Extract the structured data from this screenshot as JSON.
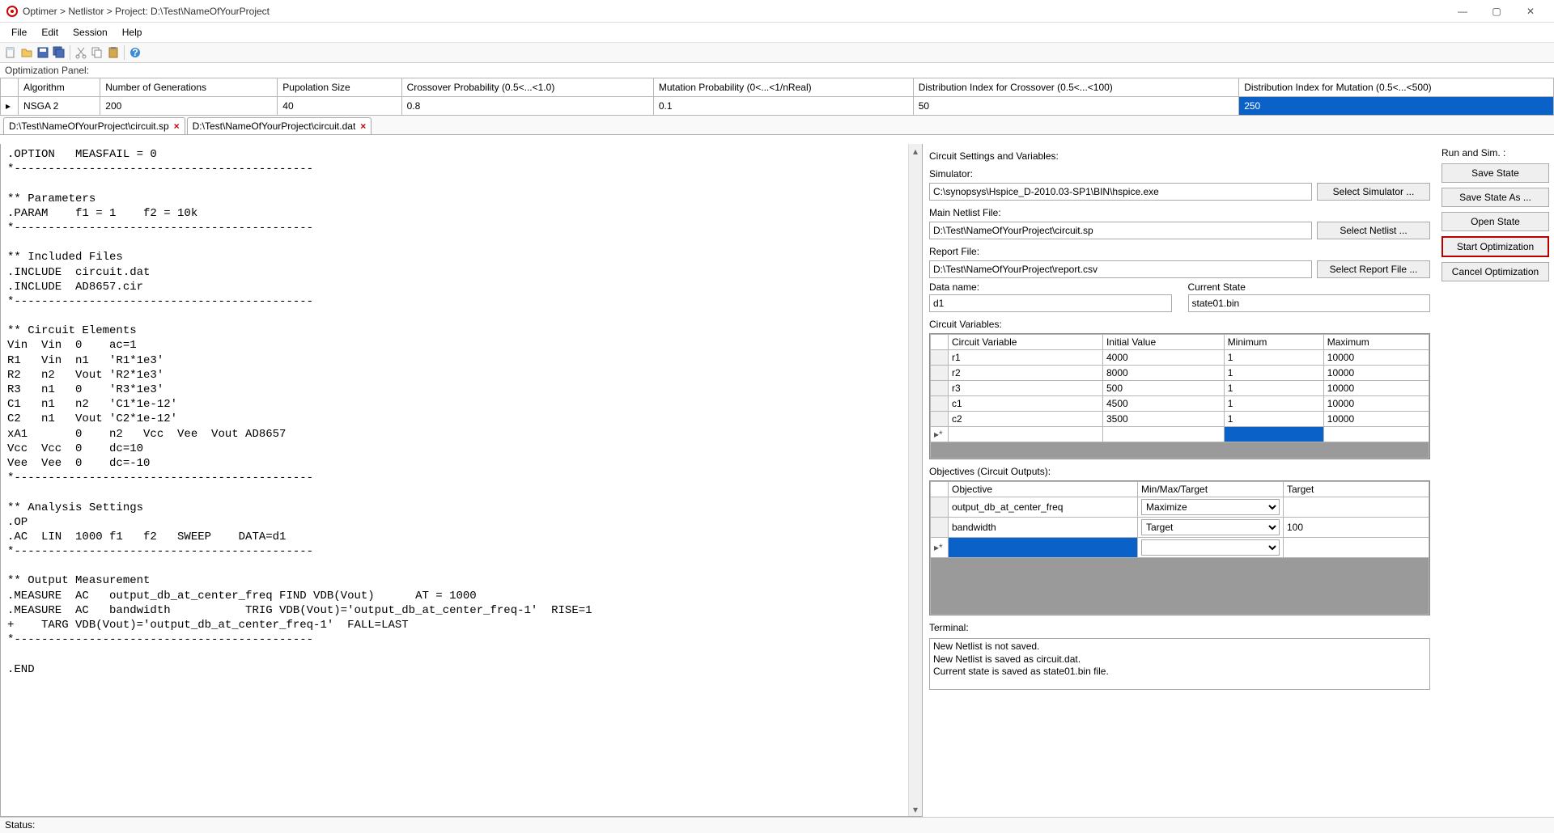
{
  "title": "Optimer > Netlistor > Project: D:\\Test\\NameOfYourProject",
  "menu": {
    "file": "File",
    "edit": "Edit",
    "session": "Session",
    "help": "Help"
  },
  "panel_label": "Optimization Panel:",
  "opt_headers": {
    "algorithm": "Algorithm",
    "generations": "Number of Generations",
    "popsize": "Pupolation Size",
    "crossover": "Crossover Probability (0.5<...<1.0)",
    "mutation": "Mutation Probability (0<...<1/nReal)",
    "dist_cross": "Distribution Index for Crossover (0.5<...<100)",
    "dist_mut": "Distribution Index for Mutation (0.5<...<500)"
  },
  "opt_row": {
    "algorithm": "NSGA 2",
    "generations": "200",
    "popsize": "40",
    "crossover": "0.8",
    "mutation": "0.1",
    "dist_cross": "50",
    "dist_mut": "250"
  },
  "tabs": {
    "t1": "D:\\Test\\NameOfYourProject\\circuit.sp",
    "t2": "D:\\Test\\NameOfYourProject\\circuit.dat"
  },
  "editor_text": ".OPTION   MEASFAIL = 0\n*--------------------------------------------\n\n** Parameters\n.PARAM    f1 = 1    f2 = 10k\n*--------------------------------------------\n\n** Included Files\n.INCLUDE  circuit.dat\n.INCLUDE  AD8657.cir\n*--------------------------------------------\n\n** Circuit Elements\nVin  Vin  0    ac=1\nR1   Vin  n1   'R1*1e3'\nR2   n2   Vout 'R2*1e3'\nR3   n1   0    'R3*1e3'\nC1   n1   n2   'C1*1e-12'\nC2   n1   Vout 'C2*1e-12'\nxA1       0    n2   Vcc  Vee  Vout AD8657\nVcc  Vcc  0    dc=10\nVee  Vee  0    dc=-10\n*--------------------------------------------\n\n** Analysis Settings\n.OP\n.AC  LIN  1000 f1   f2   SWEEP    DATA=d1\n*--------------------------------------------\n\n** Output Measurement\n.MEASURE  AC   output_db_at_center_freq FIND VDB(Vout)      AT = 1000\n.MEASURE  AC   bandwidth           TRIG VDB(Vout)='output_db_at_center_freq-1'  RISE=1\n+    TARG VDB(Vout)='output_db_at_center_freq-1'  FALL=LAST\n*--------------------------------------------\n\n.END",
  "settings": {
    "title": "Circuit Settings and Variables:",
    "sim_label": "Simulator:",
    "sim_value": "C:\\synopsys\\Hspice_D-2010.03-SP1\\BIN\\hspice.exe",
    "sim_btn": "Select Simulator ...",
    "netlist_label": "Main Netlist File:",
    "netlist_value": "D:\\Test\\NameOfYourProject\\circuit.sp",
    "netlist_btn": "Select Netlist ...",
    "report_label": "Report File:",
    "report_value": "D:\\Test\\NameOfYourProject\\report.csv",
    "report_btn": "Select Report File ...",
    "dataname_label": "Data name:",
    "dataname_value": "d1",
    "state_label": "Current State",
    "state_value": "state01.bin",
    "vars_label": "Circuit Variables:",
    "vars_headers": {
      "v": "Circuit Variable",
      "iv": "Initial Value",
      "min": "Minimum",
      "max": "Maximum"
    },
    "vars": [
      {
        "v": "r1",
        "iv": "4000",
        "min": "1",
        "max": "10000"
      },
      {
        "v": "r2",
        "iv": "8000",
        "min": "1",
        "max": "10000"
      },
      {
        "v": "r3",
        "iv": "500",
        "min": "1",
        "max": "10000"
      },
      {
        "v": "c1",
        "iv": "4500",
        "min": "1",
        "max": "10000"
      },
      {
        "v": "c2",
        "iv": "3500",
        "min": "1",
        "max": "10000"
      }
    ],
    "obj_label": "Objectives (Circuit Outputs):",
    "obj_headers": {
      "o": "Objective",
      "m": "Min/Max/Target",
      "t": "Target"
    },
    "objs": [
      {
        "o": "output_db_at_center_freq",
        "m": "Maximize",
        "t": ""
      },
      {
        "o": "bandwidth",
        "m": "Target",
        "t": "100"
      }
    ],
    "term_label": "Terminal:",
    "term_lines": "New Netlist is not saved.\nNew Netlist is saved as circuit.dat.\nCurrent state is saved as state01.bin file."
  },
  "run": {
    "title": "Run and Sim. :",
    "save": "Save State",
    "saveas": "Save State As ...",
    "open": "Open State",
    "start": "Start Optimization",
    "cancel": "Cancel Optimization"
  },
  "status": "Status:"
}
